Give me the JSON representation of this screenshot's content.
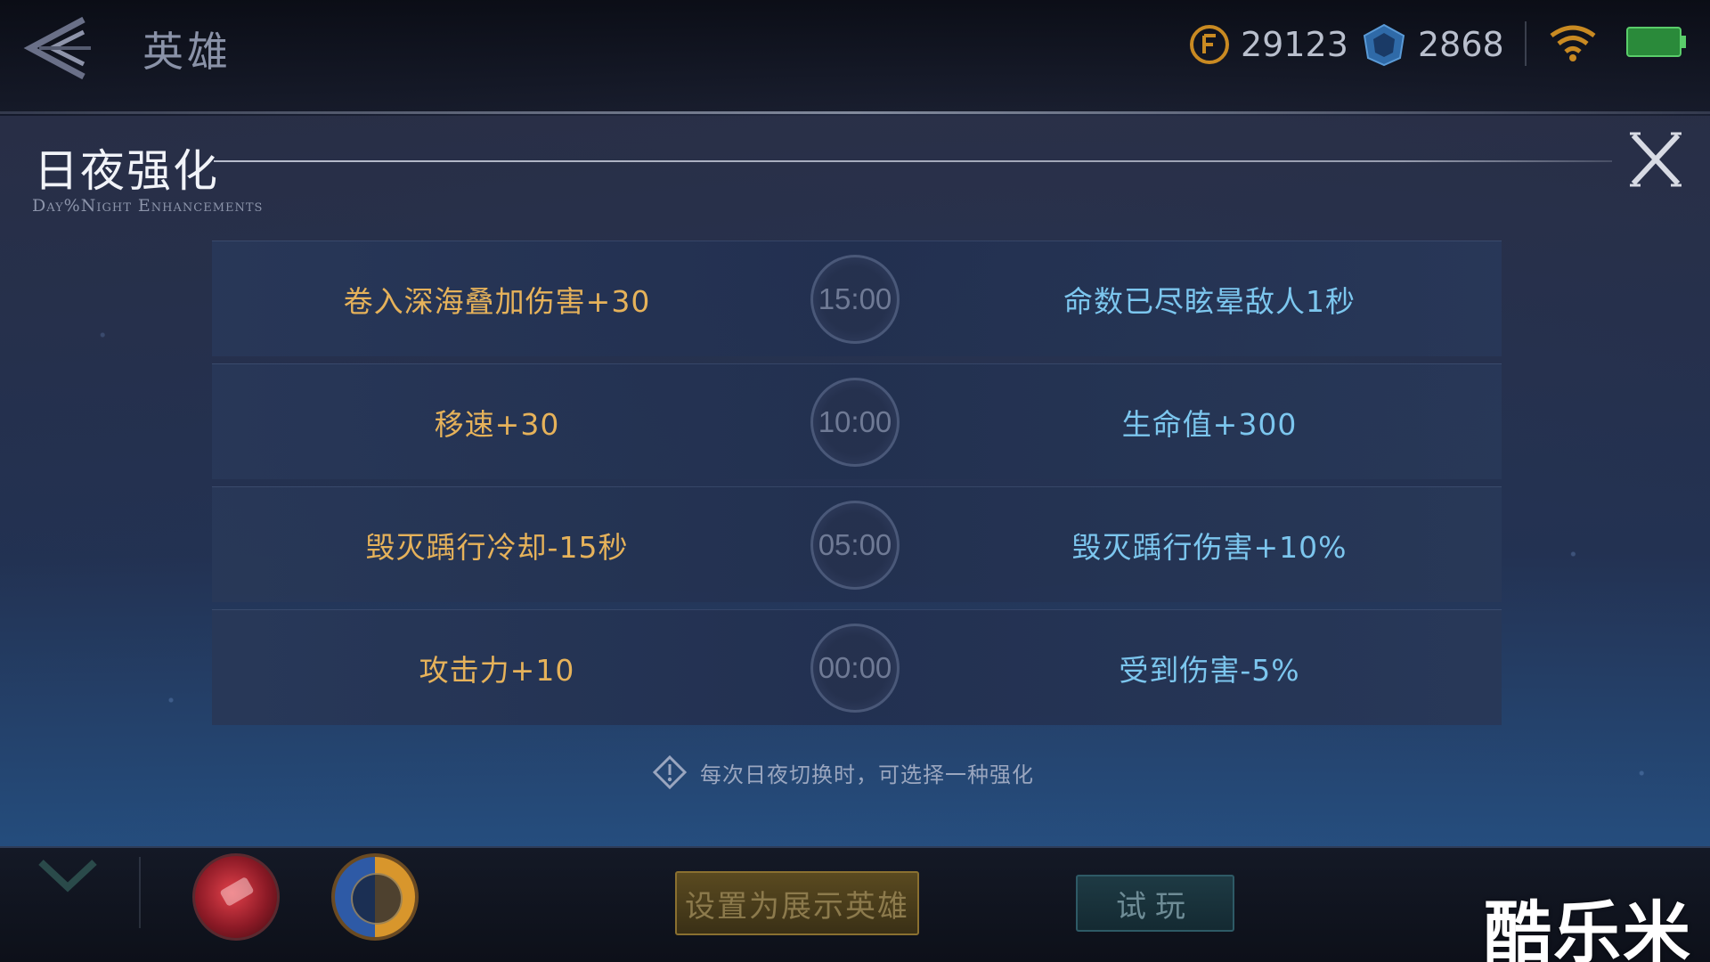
{
  "header": {
    "title": "英雄",
    "gold": "29123",
    "gems": "2868"
  },
  "panel": {
    "title": "日夜强化",
    "subtitle": "Day%Night Enhancements",
    "rows": [
      {
        "day": "卷入深海叠加伤害+30",
        "time": "15:00",
        "night": "命数已尽眩晕敌人1秒"
      },
      {
        "day": "移速+30",
        "time": "10:00",
        "night": "生命值+300"
      },
      {
        "day": "毁灭踽行冷却-15秒",
        "time": "05:00",
        "night": "毁灭踽行伤害+10%"
      },
      {
        "day": "攻击力+10",
        "time": "00:00",
        "night": "受到伤害-5%"
      }
    ],
    "hint": "每次日夜切换时，可选择一种强化"
  },
  "bottom": {
    "showcase_label": "设置为展示英雄",
    "trial_label": "试玩"
  },
  "watermark": "酷乐米",
  "colors": {
    "day_text": "#e6b25a",
    "night_text": "#7cc6ee",
    "accent_gold": "#c98a22",
    "accent_gem": "#3a78b8"
  },
  "icons": [
    "back-arrow-icon",
    "gold-coin-icon",
    "gem-icon",
    "wifi-icon",
    "battery-icon",
    "close-icon",
    "info-diamond-icon",
    "chevron-down-icon"
  ]
}
